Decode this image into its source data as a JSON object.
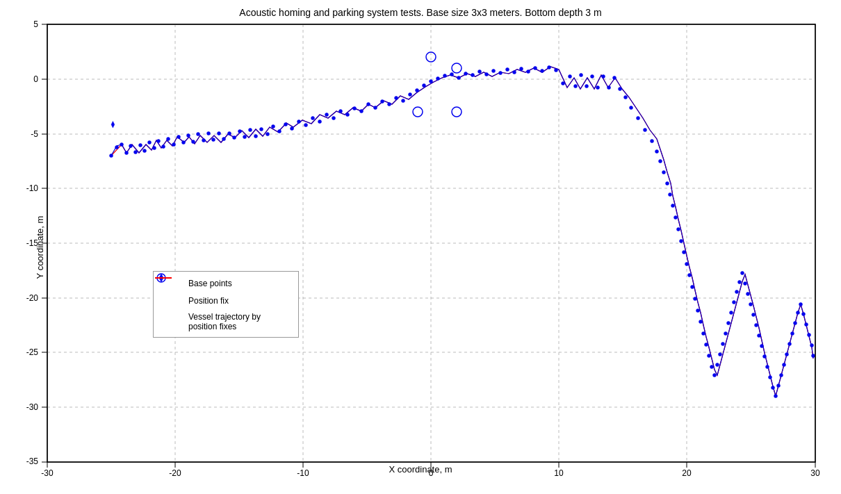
{
  "chart": {
    "title": "Acoustic homing and parking system tests. Base size 3x3 meters. Bottom depth 3 m",
    "x_label": "X coordinate, m",
    "y_label": "Y coordinate, m",
    "x_min": -30,
    "x_max": 30,
    "y_min": -35,
    "y_max": 5
  },
  "legend": {
    "items": [
      {
        "label": "Base points",
        "type": "circle"
      },
      {
        "label": "Position fix",
        "type": "diamond"
      },
      {
        "label": "Vessel trajectory by position fixes",
        "type": "line"
      }
    ]
  }
}
